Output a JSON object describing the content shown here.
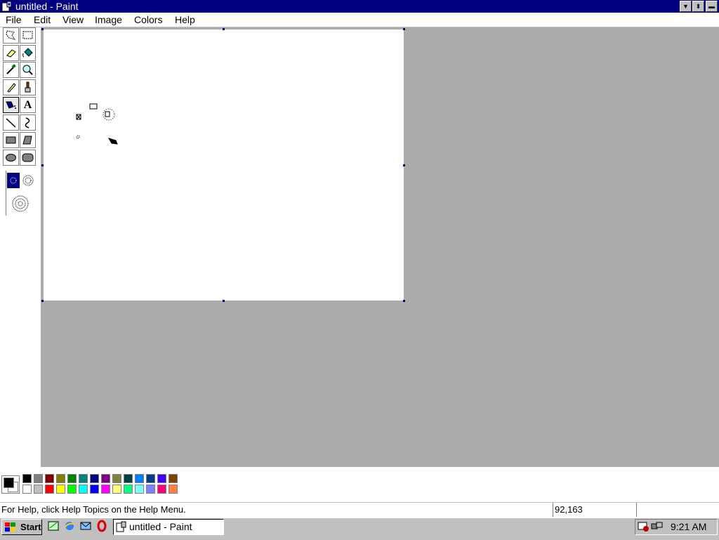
{
  "window": {
    "title": "untitled - Paint"
  },
  "menu": [
    {
      "label": "File"
    },
    {
      "label": "Edit"
    },
    {
      "label": "View"
    },
    {
      "label": "Image"
    },
    {
      "label": "Colors"
    },
    {
      "label": "Help"
    }
  ],
  "tools": [
    "free-form-select-icon",
    "select-icon",
    "eraser-icon",
    "fill-icon",
    "pick-color-icon",
    "magnifier-icon",
    "pencil-icon",
    "brush-icon",
    "airbrush-icon",
    "text-icon",
    "line-icon",
    "curve-icon",
    "rectangle-icon",
    "polygon-icon",
    "ellipse-icon",
    "rounded-rectangle-icon"
  ],
  "text_tool_glyph": "A",
  "palette": {
    "top": [
      "#000000",
      "#808080",
      "#800000",
      "#808000",
      "#008000",
      "#008080",
      "#000080",
      "#800080",
      "#808040",
      "#004040",
      "#0080ff",
      "#004080",
      "#4000ff",
      "#804000"
    ],
    "bottom": [
      "#ffffff",
      "#c0c0c0",
      "#ff0000",
      "#ffff00",
      "#00ff00",
      "#00ffff",
      "#0000ff",
      "#ff00ff",
      "#ffff80",
      "#00ff80",
      "#80ffff",
      "#8080ff",
      "#ff0080",
      "#ff8040"
    ],
    "foreground": "#000000",
    "background": "#ffffff"
  },
  "status": {
    "help": "For Help, click Help Topics on the Help Menu.",
    "coords": "92,163"
  },
  "taskbar": {
    "start_label": "Start",
    "task_label": "untitled - Paint",
    "clock": "9:21 AM"
  },
  "colors": {
    "titlebar": "#000080",
    "workspace": "#ababab"
  }
}
